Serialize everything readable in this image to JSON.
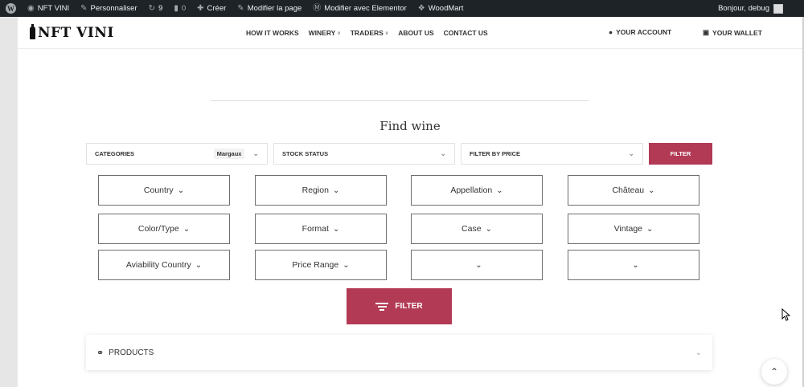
{
  "adminbar": {
    "site_name": "NFT VINI",
    "customize": "Personnaliser",
    "updates_count": "9",
    "comments_count": "0",
    "new": "Créer",
    "edit_page": "Modifier la page",
    "edit_elementor": "Modifier avec Elementor",
    "woodmart": "WoodMart",
    "greeting": "Bonjour, debug"
  },
  "header": {
    "logo": "NFT VINI",
    "nav": [
      {
        "label": "HOW IT WORKS",
        "has_caret": false
      },
      {
        "label": "WINERY",
        "has_caret": true
      },
      {
        "label": "TRADERS",
        "has_caret": true
      },
      {
        "label": "ABOUT US",
        "has_caret": false
      },
      {
        "label": "CONTACT US",
        "has_caret": false
      }
    ],
    "account": "YOUR ACCOUNT",
    "wallet": "YOUR WALLET"
  },
  "find": {
    "title": "Find wine",
    "categories_label": "CATEGORIES",
    "categories_value": "Margaux",
    "stock_label": "STOCK STATUS",
    "price_label": "FILTER BY PRICE",
    "filter_button": "FILTER"
  },
  "dropdowns": [
    [
      "Country",
      "Region",
      "Appellation",
      "Château"
    ],
    [
      "Color/Type",
      "Format",
      "Case",
      "Vintage"
    ],
    [
      "Aviability Country",
      "Price Range",
      "",
      ""
    ]
  ],
  "big_filter_button": "FILTER",
  "products_label": "PRODUCTS",
  "colors": {
    "accent": "#b23a55",
    "adminbar": "#1d2327"
  }
}
